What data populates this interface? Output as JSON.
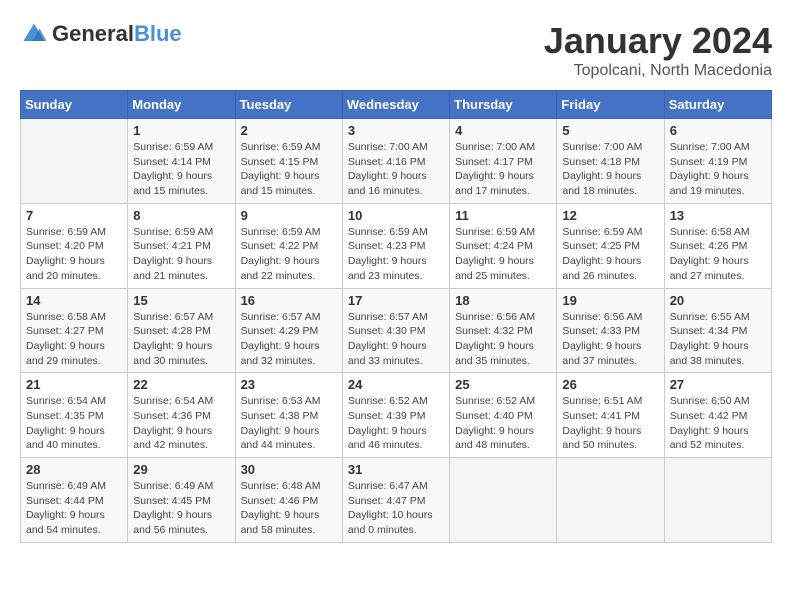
{
  "logo": {
    "general": "General",
    "blue": "Blue"
  },
  "header": {
    "month": "January 2024",
    "location": "Topolcani, North Macedonia"
  },
  "weekdays": [
    "Sunday",
    "Monday",
    "Tuesday",
    "Wednesday",
    "Thursday",
    "Friday",
    "Saturday"
  ],
  "weeks": [
    [
      {
        "day": "",
        "sunrise": "",
        "sunset": "",
        "daylight": ""
      },
      {
        "day": "1",
        "sunrise": "Sunrise: 6:59 AM",
        "sunset": "Sunset: 4:14 PM",
        "daylight": "Daylight: 9 hours and 15 minutes."
      },
      {
        "day": "2",
        "sunrise": "Sunrise: 6:59 AM",
        "sunset": "Sunset: 4:15 PM",
        "daylight": "Daylight: 9 hours and 15 minutes."
      },
      {
        "day": "3",
        "sunrise": "Sunrise: 7:00 AM",
        "sunset": "Sunset: 4:16 PM",
        "daylight": "Daylight: 9 hours and 16 minutes."
      },
      {
        "day": "4",
        "sunrise": "Sunrise: 7:00 AM",
        "sunset": "Sunset: 4:17 PM",
        "daylight": "Daylight: 9 hours and 17 minutes."
      },
      {
        "day": "5",
        "sunrise": "Sunrise: 7:00 AM",
        "sunset": "Sunset: 4:18 PM",
        "daylight": "Daylight: 9 hours and 18 minutes."
      },
      {
        "day": "6",
        "sunrise": "Sunrise: 7:00 AM",
        "sunset": "Sunset: 4:19 PM",
        "daylight": "Daylight: 9 hours and 19 minutes."
      }
    ],
    [
      {
        "day": "7",
        "sunrise": "Sunrise: 6:59 AM",
        "sunset": "Sunset: 4:20 PM",
        "daylight": "Daylight: 9 hours and 20 minutes."
      },
      {
        "day": "8",
        "sunrise": "Sunrise: 6:59 AM",
        "sunset": "Sunset: 4:21 PM",
        "daylight": "Daylight: 9 hours and 21 minutes."
      },
      {
        "day": "9",
        "sunrise": "Sunrise: 6:59 AM",
        "sunset": "Sunset: 4:22 PM",
        "daylight": "Daylight: 9 hours and 22 minutes."
      },
      {
        "day": "10",
        "sunrise": "Sunrise: 6:59 AM",
        "sunset": "Sunset: 4:23 PM",
        "daylight": "Daylight: 9 hours and 23 minutes."
      },
      {
        "day": "11",
        "sunrise": "Sunrise: 6:59 AM",
        "sunset": "Sunset: 4:24 PM",
        "daylight": "Daylight: 9 hours and 25 minutes."
      },
      {
        "day": "12",
        "sunrise": "Sunrise: 6:59 AM",
        "sunset": "Sunset: 4:25 PM",
        "daylight": "Daylight: 9 hours and 26 minutes."
      },
      {
        "day": "13",
        "sunrise": "Sunrise: 6:58 AM",
        "sunset": "Sunset: 4:26 PM",
        "daylight": "Daylight: 9 hours and 27 minutes."
      }
    ],
    [
      {
        "day": "14",
        "sunrise": "Sunrise: 6:58 AM",
        "sunset": "Sunset: 4:27 PM",
        "daylight": "Daylight: 9 hours and 29 minutes."
      },
      {
        "day": "15",
        "sunrise": "Sunrise: 6:57 AM",
        "sunset": "Sunset: 4:28 PM",
        "daylight": "Daylight: 9 hours and 30 minutes."
      },
      {
        "day": "16",
        "sunrise": "Sunrise: 6:57 AM",
        "sunset": "Sunset: 4:29 PM",
        "daylight": "Daylight: 9 hours and 32 minutes."
      },
      {
        "day": "17",
        "sunrise": "Sunrise: 6:57 AM",
        "sunset": "Sunset: 4:30 PM",
        "daylight": "Daylight: 9 hours and 33 minutes."
      },
      {
        "day": "18",
        "sunrise": "Sunrise: 6:56 AM",
        "sunset": "Sunset: 4:32 PM",
        "daylight": "Daylight: 9 hours and 35 minutes."
      },
      {
        "day": "19",
        "sunrise": "Sunrise: 6:56 AM",
        "sunset": "Sunset: 4:33 PM",
        "daylight": "Daylight: 9 hours and 37 minutes."
      },
      {
        "day": "20",
        "sunrise": "Sunrise: 6:55 AM",
        "sunset": "Sunset: 4:34 PM",
        "daylight": "Daylight: 9 hours and 38 minutes."
      }
    ],
    [
      {
        "day": "21",
        "sunrise": "Sunrise: 6:54 AM",
        "sunset": "Sunset: 4:35 PM",
        "daylight": "Daylight: 9 hours and 40 minutes."
      },
      {
        "day": "22",
        "sunrise": "Sunrise: 6:54 AM",
        "sunset": "Sunset: 4:36 PM",
        "daylight": "Daylight: 9 hours and 42 minutes."
      },
      {
        "day": "23",
        "sunrise": "Sunrise: 6:53 AM",
        "sunset": "Sunset: 4:38 PM",
        "daylight": "Daylight: 9 hours and 44 minutes."
      },
      {
        "day": "24",
        "sunrise": "Sunrise: 6:52 AM",
        "sunset": "Sunset: 4:39 PM",
        "daylight": "Daylight: 9 hours and 46 minutes."
      },
      {
        "day": "25",
        "sunrise": "Sunrise: 6:52 AM",
        "sunset": "Sunset: 4:40 PM",
        "daylight": "Daylight: 9 hours and 48 minutes."
      },
      {
        "day": "26",
        "sunrise": "Sunrise: 6:51 AM",
        "sunset": "Sunset: 4:41 PM",
        "daylight": "Daylight: 9 hours and 50 minutes."
      },
      {
        "day": "27",
        "sunrise": "Sunrise: 6:50 AM",
        "sunset": "Sunset: 4:42 PM",
        "daylight": "Daylight: 9 hours and 52 minutes."
      }
    ],
    [
      {
        "day": "28",
        "sunrise": "Sunrise: 6:49 AM",
        "sunset": "Sunset: 4:44 PM",
        "daylight": "Daylight: 9 hours and 54 minutes."
      },
      {
        "day": "29",
        "sunrise": "Sunrise: 6:49 AM",
        "sunset": "Sunset: 4:45 PM",
        "daylight": "Daylight: 9 hours and 56 minutes."
      },
      {
        "day": "30",
        "sunrise": "Sunrise: 6:48 AM",
        "sunset": "Sunset: 4:46 PM",
        "daylight": "Daylight: 9 hours and 58 minutes."
      },
      {
        "day": "31",
        "sunrise": "Sunrise: 6:47 AM",
        "sunset": "Sunset: 4:47 PM",
        "daylight": "Daylight: 10 hours and 0 minutes."
      },
      {
        "day": "",
        "sunrise": "",
        "sunset": "",
        "daylight": ""
      },
      {
        "day": "",
        "sunrise": "",
        "sunset": "",
        "daylight": ""
      },
      {
        "day": "",
        "sunrise": "",
        "sunset": "",
        "daylight": ""
      }
    ]
  ]
}
